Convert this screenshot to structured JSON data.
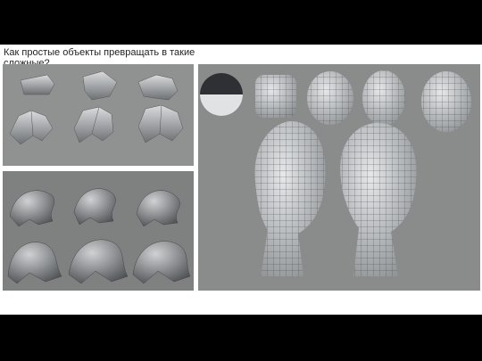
{
  "slide": {
    "caption": "Как простые объекты превращать в такие сложные?"
  },
  "images": [
    {
      "name": "blockout-creature-progression"
    },
    {
      "name": "sculpted-creature-progression"
    },
    {
      "name": "head-modeling-progression"
    }
  ],
  "colors": {
    "background": "#000000",
    "slide": "#ffffff",
    "panel_gray": "#8e8f8f",
    "mesh_light": "#d4d6d8",
    "mesh_line": "#4a4d50"
  }
}
